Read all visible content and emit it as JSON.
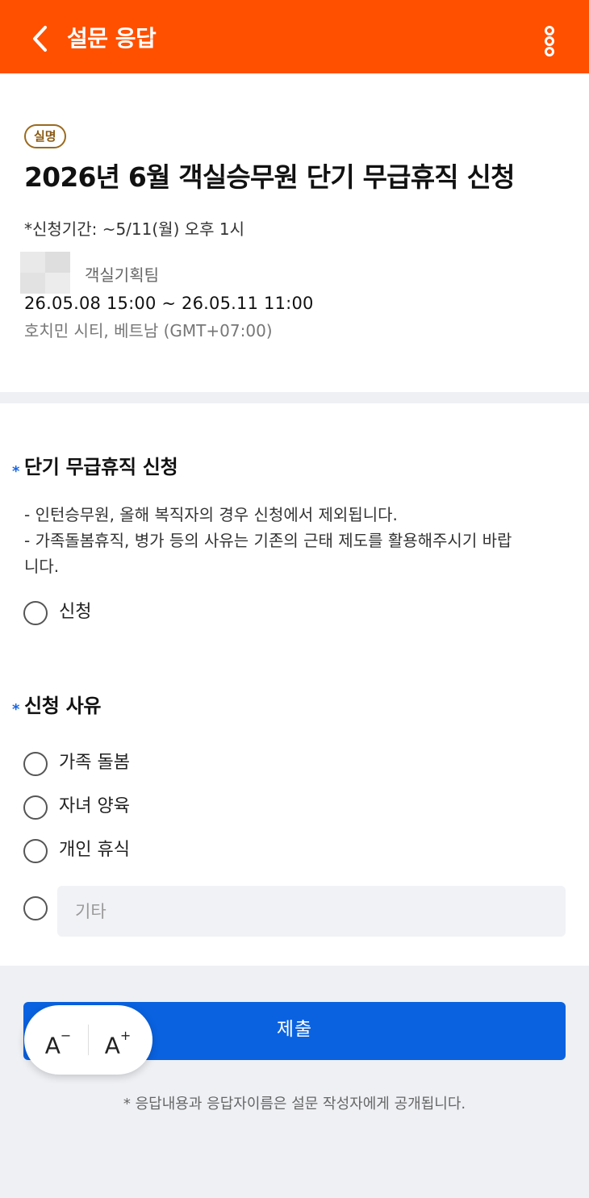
{
  "header": {
    "title": "설문 응답",
    "back_icon": "chevron-left-icon",
    "menu_icon": "more-vertical-icon",
    "color": "#ff5000"
  },
  "survey": {
    "badge": "실명",
    "title": "2026년 6월 객실승무원 단기 무급휴직 신청",
    "period": "*신청기간: ~5/11(월) 오후 1시",
    "team": "객실기획팀",
    "date_range": "26.05.08 15:00 ~ 26.05.11 11:00",
    "timezone": "호치민 시티, 베트남 (GMT+07:00)"
  },
  "questions": [
    {
      "required": "*",
      "title": "단기 무급휴직 신청",
      "description": [
        "- 인턴승무원, 올해 복직자의 경우 신청에서 제외됩니다.",
        "- 가족돌봄휴직, 병가 등의 사유는 기존의 근태 제도를 활용해주시기 바랍",
        "니다."
      ],
      "options": [
        "신청"
      ]
    },
    {
      "required": "*",
      "title": "신청 사유",
      "options": [
        "가족 돌봄",
        "자녀 양육",
        "개인 휴식"
      ],
      "other_placeholder": "기타"
    }
  ],
  "submit_label": "제출",
  "font_controls": {
    "decrease": "A",
    "increase": "A",
    "decrease_sign": "−",
    "increase_sign": "+"
  },
  "notice": "* 응답내용과 응답자이름은 설문 작성자에게 공개됩니다.",
  "colors": {
    "accent": "#0a62e0",
    "required": "#1a66e0",
    "badge": "#9a6a1f"
  }
}
